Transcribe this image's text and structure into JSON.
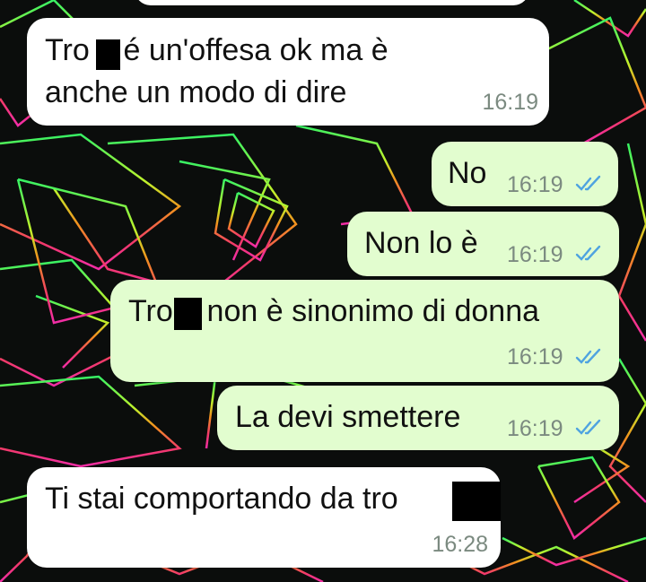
{
  "chat": {
    "messages": [
      {
        "direction": "incoming",
        "line1": "Tro a é un'offesa ok ma è",
        "line2": "anche un modo di dire",
        "time": "16:19"
      },
      {
        "direction": "outgoing",
        "text": "No",
        "time": "16:19",
        "status": "read-double-check"
      },
      {
        "direction": "outgoing",
        "text": "Non lo è",
        "time": "16:19",
        "status": "read-double-check"
      },
      {
        "direction": "outgoing",
        "text": "Tro a non è sinonimo di donna",
        "time": "16:19",
        "status": "read-double-check"
      },
      {
        "direction": "outgoing",
        "text": "La devi smettere",
        "time": "16:19",
        "status": "read-double-check"
      },
      {
        "direction": "incoming",
        "text": "Ti stai comportando da tro",
        "time": "16:28"
      }
    ]
  },
  "colors": {
    "incoming_bubble": "#ffffff",
    "outgoing_bubble": "#e2fdcf",
    "timestamp": "#7b8a80",
    "read_ticks": "#4fa3e0",
    "redaction": "#000000"
  },
  "icons": {
    "read_status": "double-check-icon"
  }
}
